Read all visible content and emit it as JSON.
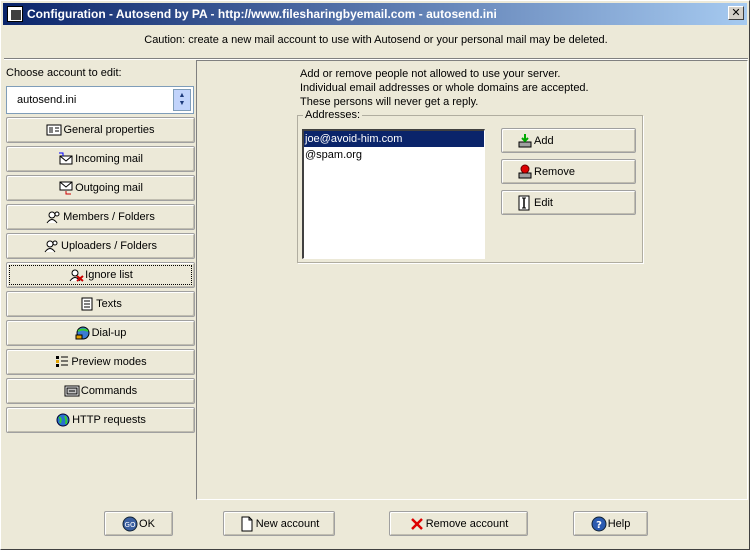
{
  "window": {
    "title": "Configuration - Autosend by PA - http://www.filesharingbyemail.com - autosend.ini",
    "close_label": "✕"
  },
  "caution": "Caution: create a new mail account to use with Autosend or your personal mail may be deleted.",
  "sidebar": {
    "choose_label": "Choose account to edit:",
    "account_selected": "autosend.ini",
    "items": [
      {
        "label": "General properties",
        "icon": "properties-icon"
      },
      {
        "label": "Incoming mail",
        "icon": "incoming-mail-icon"
      },
      {
        "label": "Outgoing mail",
        "icon": "outgoing-mail-icon"
      },
      {
        "label": "Members / Folders",
        "icon": "members-icon"
      },
      {
        "label": "Uploaders / Folders",
        "icon": "uploaders-icon"
      },
      {
        "label": "Ignore list",
        "icon": "ignore-icon"
      },
      {
        "label": "Texts",
        "icon": "texts-icon"
      },
      {
        "label": "Dial-up",
        "icon": "dialup-icon"
      },
      {
        "label": "Preview modes",
        "icon": "preview-icon"
      },
      {
        "label": "Commands",
        "icon": "commands-icon"
      },
      {
        "label": "HTTP requests",
        "icon": "globe-icon"
      }
    ]
  },
  "panel": {
    "lines": [
      "Add or remove people not allowed to use your server.",
      "Individual email addresses or whole domains are accepted.",
      "These persons will never get a reply."
    ],
    "addresses_label": "Addresses:",
    "addresses": [
      "joe@avoid-him.com",
      "@spam.org"
    ],
    "buttons": {
      "add": "Add",
      "remove": "Remove",
      "edit": "Edit"
    }
  },
  "footer": {
    "ok": "OK",
    "new_account": "New account",
    "remove_account": "Remove account",
    "help": "Help"
  }
}
